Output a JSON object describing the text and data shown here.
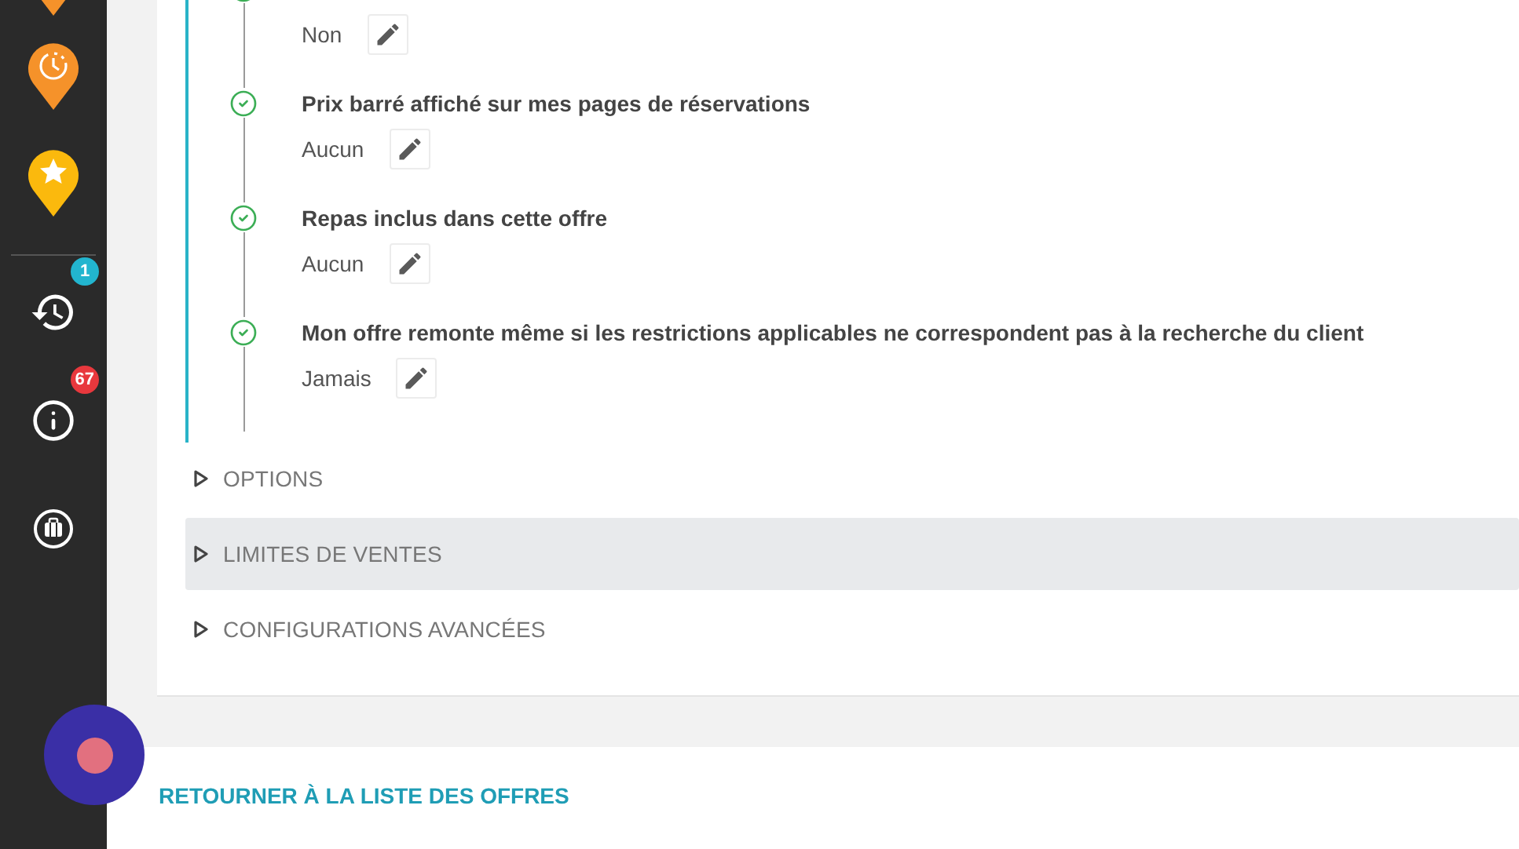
{
  "sidebar": {
    "badges": [
      {
        "text": "1",
        "color": "#22b5cf"
      },
      {
        "text": "67",
        "color": "#e8383d"
      }
    ]
  },
  "settings": [
    {
      "value": "Non",
      "done": true
    },
    {
      "title": "Prix barré affiché sur mes pages de réservations",
      "value": "Aucun",
      "done": true
    },
    {
      "title": "Repas inclus dans cette offre",
      "value": "Aucun",
      "done": true
    },
    {
      "title": "Mon offre remonte même si les restrictions applicables ne correspondent pas à la recherche du client",
      "value": "Jamais",
      "done": true
    }
  ],
  "sections": [
    {
      "label": "OPTIONS",
      "selected": false
    },
    {
      "label": "LIMITES DE VENTES",
      "selected": true
    },
    {
      "label": "CONFIGURATIONS AVANCÉES",
      "selected": false
    }
  ],
  "footer": {
    "link": "RETOURNER À LA LISTE DES OFFRES"
  }
}
